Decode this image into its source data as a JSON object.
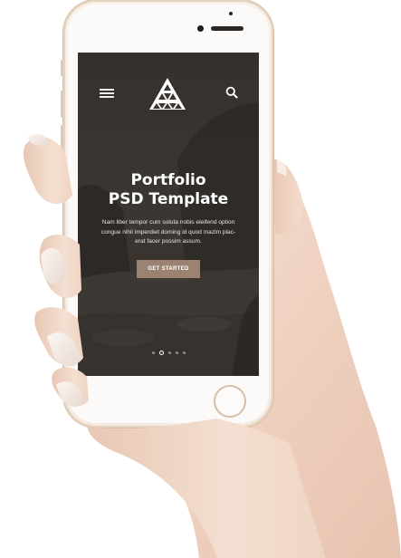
{
  "header": {
    "menu_icon": "hamburger-menu-icon",
    "logo_icon": "triangle-logo-icon",
    "search_icon": "search-icon"
  },
  "hero": {
    "title_line1": "Portfolio",
    "title_line2": "PSD Template",
    "description_lines": [
      "Nam liber tempor cum soluta nobis eleifend option",
      "congue nihil imperdiet doming id quod mazim plac-",
      "erat facer possim assum."
    ],
    "cta_label": "GET STARTED"
  },
  "pager": {
    "total": 5,
    "active_index": 1
  },
  "colors": {
    "cta": "#9c8272",
    "phone_frame": "#f3ebe2",
    "screen_bg": "#3a3531"
  }
}
